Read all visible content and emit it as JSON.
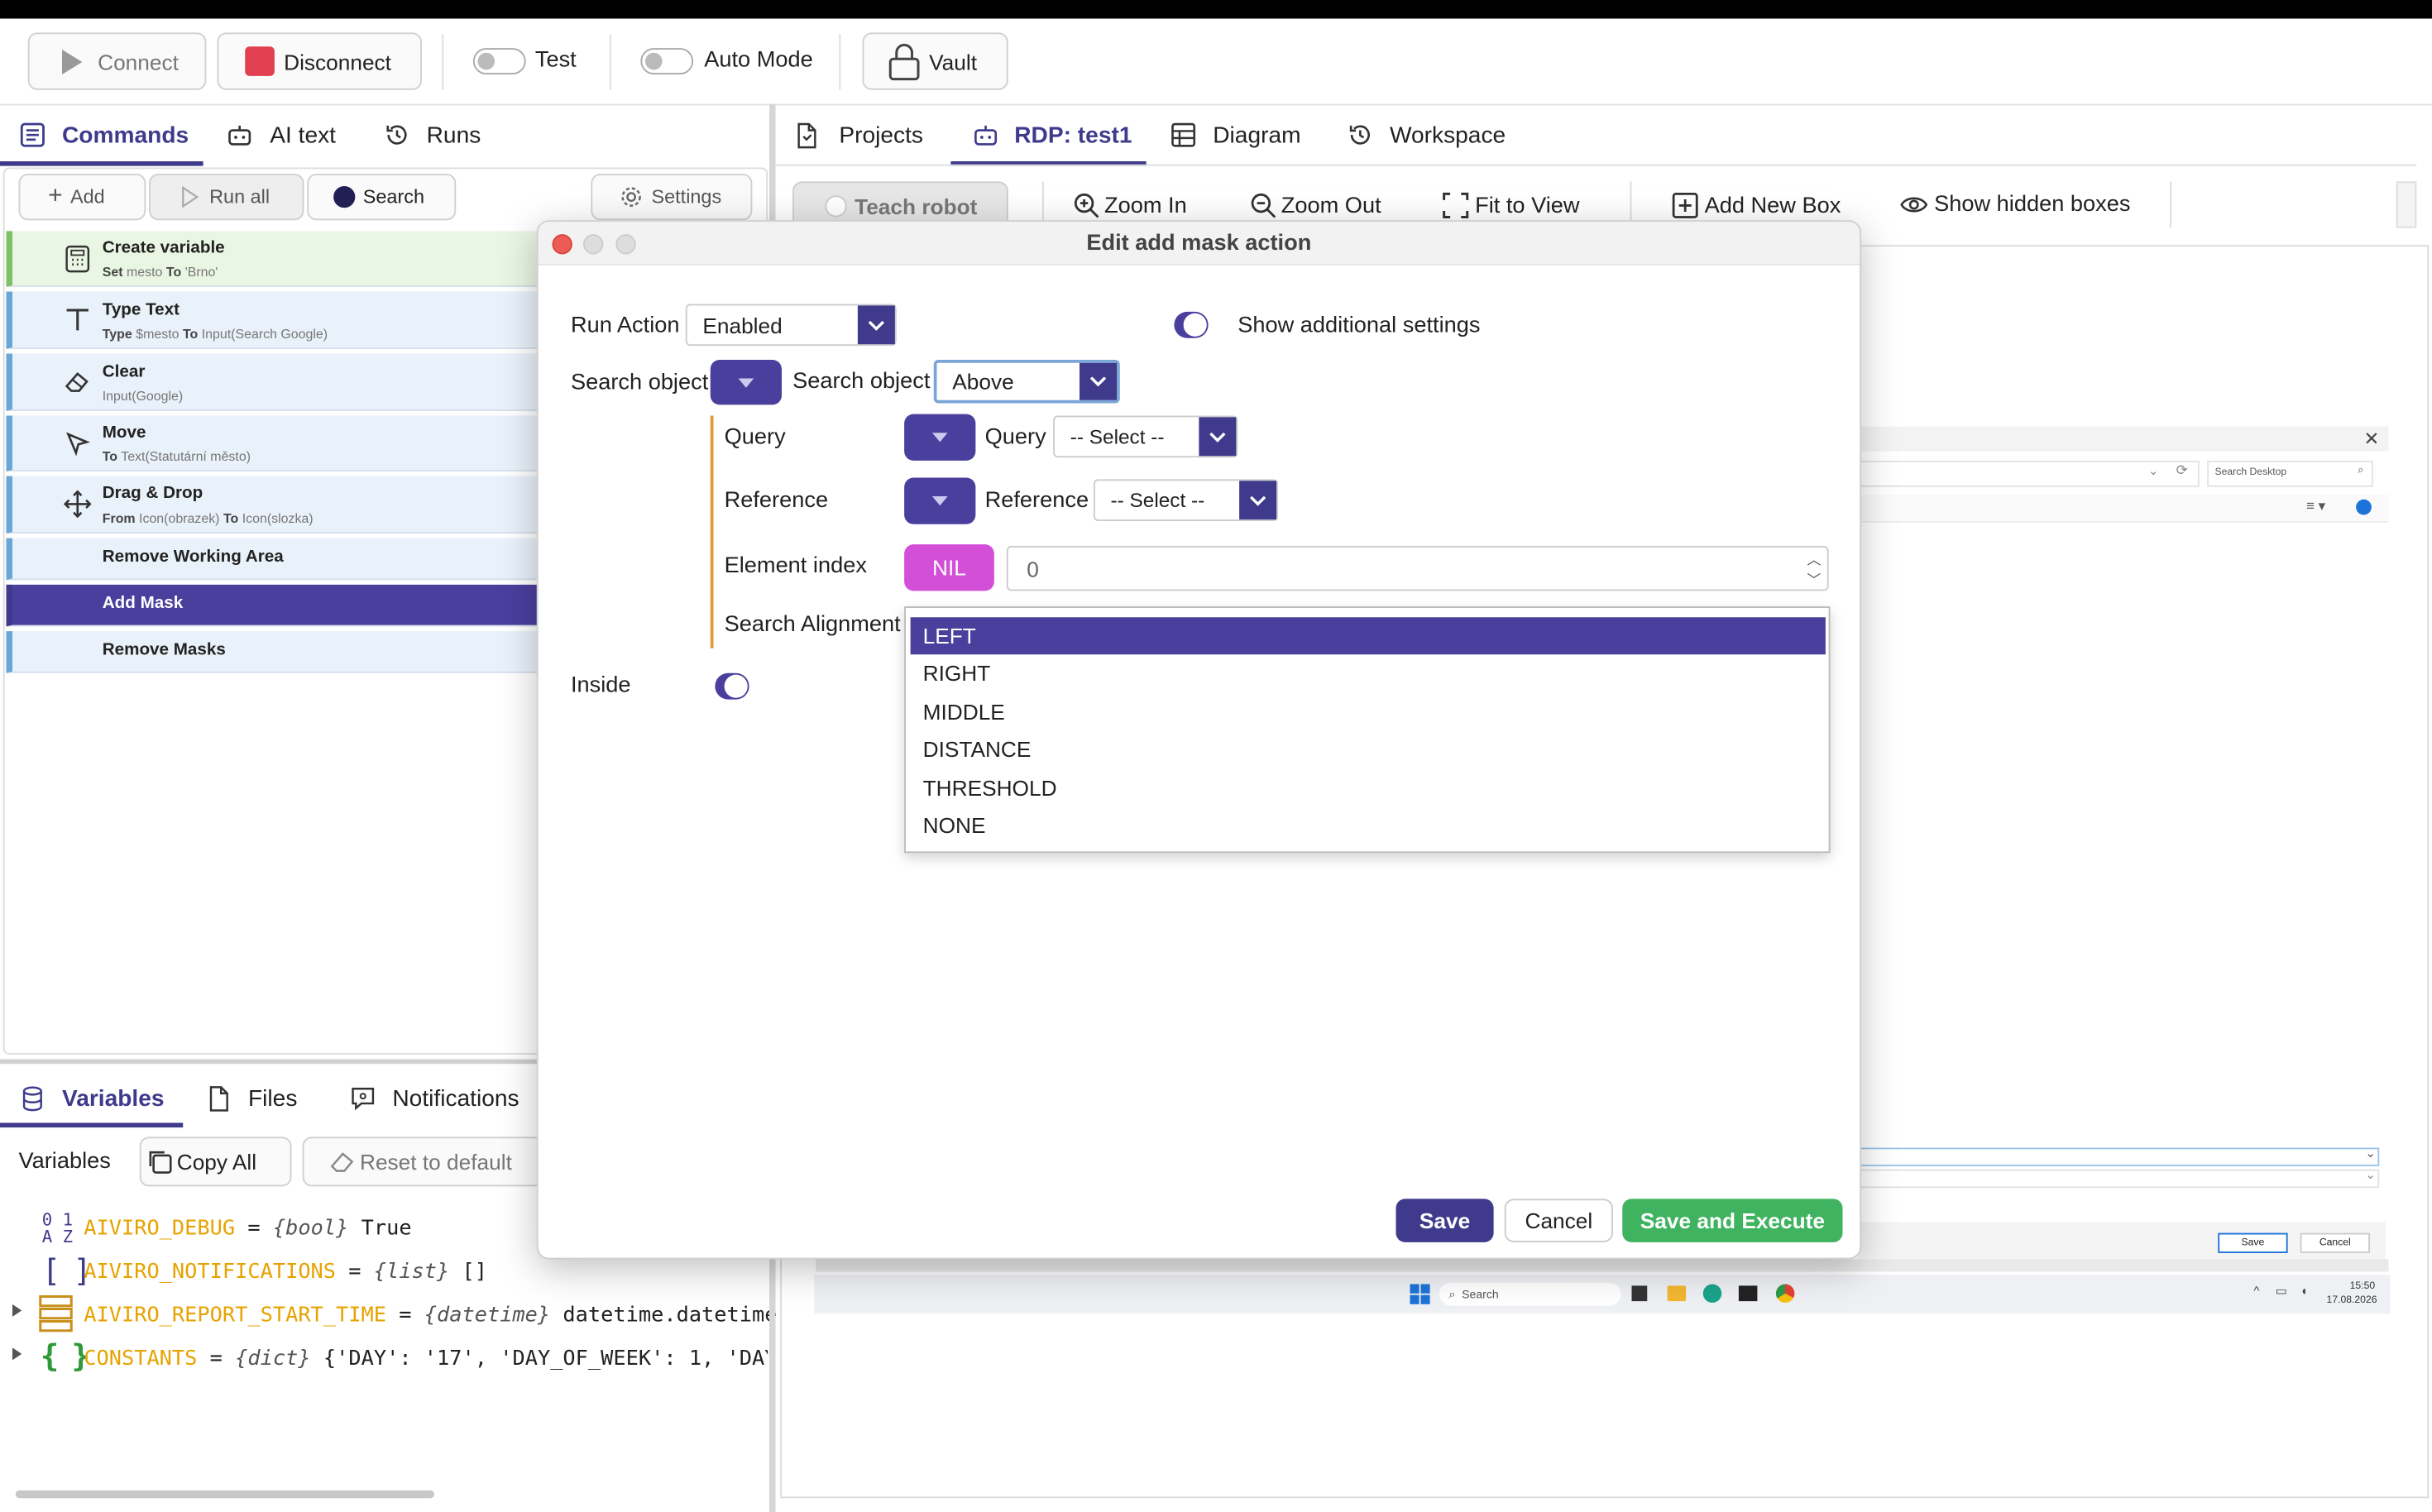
{
  "toolbar": {
    "connect_label": "Connect",
    "disconnect_label": "Disconnect",
    "test_label": "Test",
    "auto_mode_label": "Auto Mode",
    "vault_label": "Vault"
  },
  "left_tabs": [
    "Commands",
    "AI text",
    "Runs"
  ],
  "command_toolbar": {
    "add": "Add",
    "run_all": "Run all",
    "search": "Search",
    "settings": "Settings"
  },
  "commands": [
    {
      "title": "Create variable",
      "parts": [
        [
          "Set",
          "mesto"
        ],
        [
          "To",
          "'Brno'"
        ]
      ],
      "icon": "calculator-icon"
    },
    {
      "title": "Type Text",
      "parts": [
        [
          "Type",
          "$mesto"
        ],
        [
          "To",
          "Input(Search Google)"
        ]
      ],
      "icon": "text-icon"
    },
    {
      "title": "Clear",
      "parts": [
        [
          "",
          "Input(Google)"
        ]
      ],
      "icon": "eraser-icon"
    },
    {
      "title": "Move",
      "parts": [
        [
          "To",
          "Text(Statutární město)"
        ]
      ],
      "icon": "cursor-icon"
    },
    {
      "title": "Drag & Drop",
      "parts": [
        [
          "From",
          "Icon(obrazek)"
        ],
        [
          "To",
          "Icon(slozka)"
        ]
      ],
      "icon": "move-icon"
    },
    {
      "title": "Remove Working Area"
    },
    {
      "title": "Add Mask",
      "selected": true
    },
    {
      "title": "Remove Masks"
    }
  ],
  "bottom_tabs": [
    "Variables",
    "Files",
    "Notifications"
  ],
  "variables_toolbar": {
    "label": "Variables",
    "copy_all": "Copy All",
    "reset": "Reset to default"
  },
  "variables": [
    {
      "name": "AIVIRO_DEBUG",
      "type": "{bool}",
      "value": "True"
    },
    {
      "name": "AIVIRO_NOTIFICATIONS",
      "type": "{list}",
      "value": "[]"
    },
    {
      "name": "AIVIRO_REPORT_START_TIME",
      "type": "{datetime}",
      "value": "datetime.datetime"
    },
    {
      "name": "CONSTANTS",
      "type": "{dict}",
      "value": "{'DAY': '17', 'DAY_OF_WEEK': 1, 'DAY"
    }
  ],
  "right_tabs": [
    "Projects",
    "RDP: test1",
    "Diagram",
    "Workspace"
  ],
  "canvas_toolbar": {
    "teach_robot": "Teach robot",
    "zoom_in": "Zoom In",
    "zoom_out": "Zoom Out",
    "fit": "Fit to View",
    "add_box": "Add New Box",
    "show_hidden": "Show hidden boxes"
  },
  "remote": {
    "search_desktop": "Search Desktop",
    "save": "Save",
    "cancel": "Cancel",
    "taskbar_search": "Search",
    "time": "15:50",
    "date": "17.08.2026"
  },
  "dialog": {
    "title": "Edit add mask action",
    "run_action_label": "Run Action",
    "run_action_value": "Enabled",
    "show_additional": "Show additional settings",
    "search_object_label": "Search object",
    "search_object_label2": "Search object",
    "search_object_value": "Above",
    "query_label": "Query",
    "query_label2": "Query",
    "query_value": "-- Select --",
    "reference_label": "Reference",
    "reference_label2": "Reference",
    "reference_value": "-- Select --",
    "element_index_label": "Element index",
    "nil_label": "NIL",
    "element_index_value": "0",
    "search_alignment_label": "Search Alignment",
    "inside_label": "Inside",
    "alignment_options": [
      "LEFT",
      "RIGHT",
      "MIDDLE",
      "DISTANCE",
      "THRESHOLD",
      "NONE"
    ],
    "save": "Save",
    "cancel": "Cancel",
    "save_execute": "Save and Execute"
  },
  "colors": {
    "accent": "#4b3f9e",
    "magenta": "#d44fd8",
    "green": "#3fb35f",
    "disconnect_red": "#e04050"
  }
}
